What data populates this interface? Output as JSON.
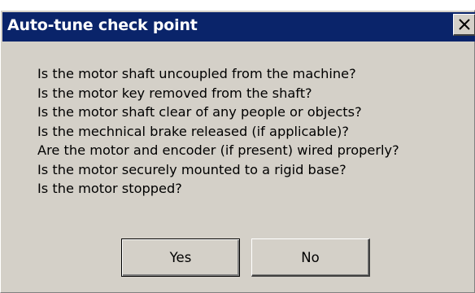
{
  "dialog": {
    "title": "Auto-tune check point",
    "close_icon": "close-icon",
    "questions": [
      "Is the motor shaft uncoupled from the machine?",
      "Is the motor key removed from the shaft?",
      "Is the motor shaft clear of any people or objects?",
      "Is the mechnical brake released (if applicable)?",
      "Are the motor and encoder (if present) wired properly?",
      "Is the motor securely mounted to a rigid base?",
      "Is the motor stopped?"
    ],
    "buttons": {
      "yes_label": "Yes",
      "no_label": "No"
    }
  },
  "colors": {
    "titlebar": "#0a246a",
    "title_text": "#ffffff",
    "face": "#d4d0c8"
  }
}
